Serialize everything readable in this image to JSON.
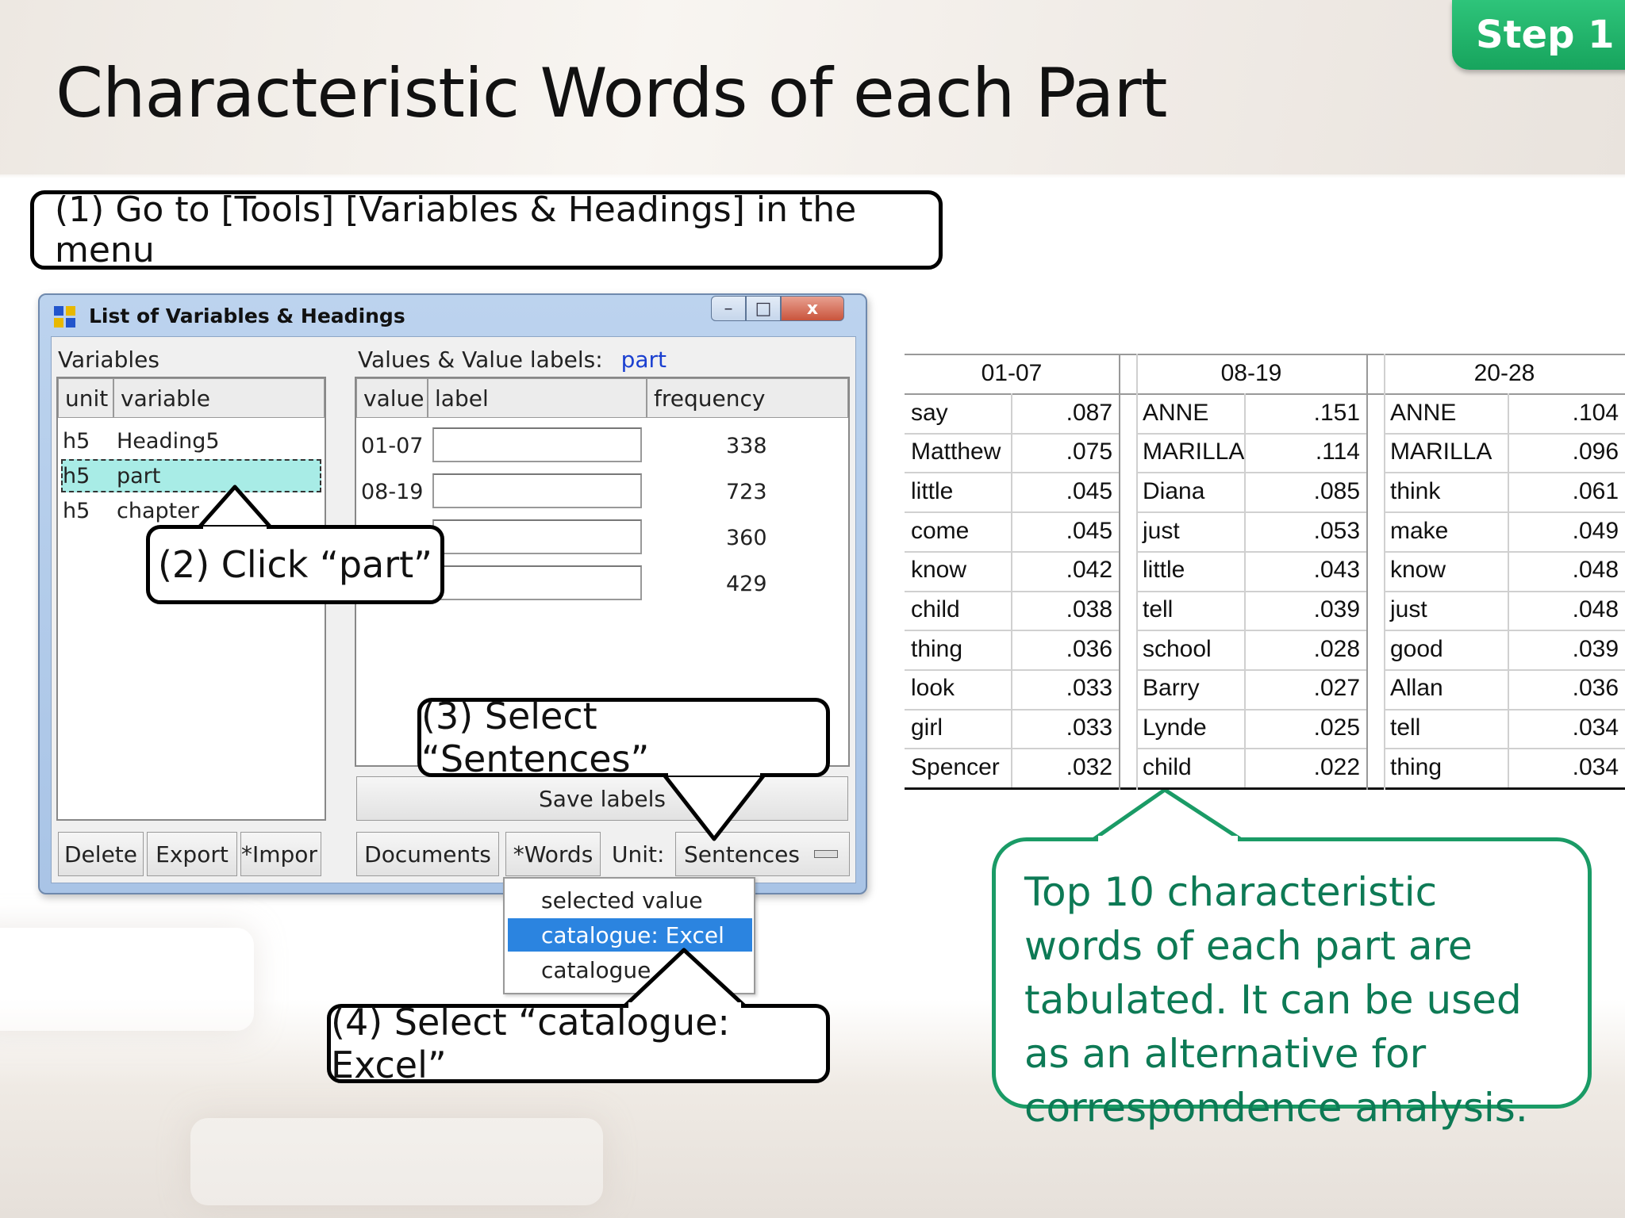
{
  "slide": {
    "title": "Characteristic Words of each Part",
    "badge": "Step 1"
  },
  "callouts": {
    "step1": "(1) Go to [Tools] [Variables & Headings] in the menu",
    "step2": "(2) Click “part”",
    "step3": "(3) Select “Sentences”",
    "step4": "(4) Select “catalogue: Excel”",
    "summary": "Top 10 characteristic words of each part are tabulated. It can be used as an alternative for correspondence analysis."
  },
  "window": {
    "title": "List of Variables & Headings",
    "controls": {
      "minimize": "–",
      "maximize": "□",
      "close": "x"
    },
    "variables_label": "Variables",
    "variables_headers": [
      "unit",
      "variable"
    ],
    "variables_rows": [
      {
        "unit": "h5",
        "variable": "Heading5"
      },
      {
        "unit": "h5",
        "variable": "part"
      },
      {
        "unit": "h5",
        "variable": "chapter"
      }
    ],
    "values_label": "Values & Value labels:",
    "values_var": "part",
    "values_headers": [
      "value",
      "label",
      "frequency"
    ],
    "values_rows": [
      {
        "value": "01-07",
        "frequency": "338"
      },
      {
        "value": "08-19",
        "frequency": "723"
      },
      {
        "value": "",
        "frequency": "360"
      },
      {
        "value": "",
        "frequency": "429"
      }
    ],
    "buttons": {
      "save_labels": "Save labels",
      "delete": "Delete",
      "export": "Export",
      "import": "*Impor",
      "documents": "Documents",
      "words": "*Words",
      "unit_label": "Unit:",
      "unit_value": "Sentences"
    },
    "dropdown": [
      "selected value",
      "catalogue: Excel",
      "catalogue"
    ]
  },
  "table": {
    "parts": [
      "01-07",
      "08-19",
      "20-28"
    ],
    "rows": [
      [
        [
          "say",
          ".087"
        ],
        [
          "ANNE",
          ".151"
        ],
        [
          "ANNE",
          ".104"
        ]
      ],
      [
        [
          "Matthew",
          ".075"
        ],
        [
          "MARILLA",
          ".114"
        ],
        [
          "MARILLA",
          ".096"
        ]
      ],
      [
        [
          "little",
          ".045"
        ],
        [
          "Diana",
          ".085"
        ],
        [
          "think",
          ".061"
        ]
      ],
      [
        [
          "come",
          ".045"
        ],
        [
          "just",
          ".053"
        ],
        [
          "make",
          ".049"
        ]
      ],
      [
        [
          "know",
          ".042"
        ],
        [
          "little",
          ".043"
        ],
        [
          "know",
          ".048"
        ]
      ],
      [
        [
          "child",
          ".038"
        ],
        [
          "tell",
          ".039"
        ],
        [
          "just",
          ".048"
        ]
      ],
      [
        [
          "thing",
          ".036"
        ],
        [
          "school",
          ".028"
        ],
        [
          "good",
          ".039"
        ]
      ],
      [
        [
          "look",
          ".033"
        ],
        [
          "Barry",
          ".027"
        ],
        [
          "Allan",
          ".036"
        ]
      ],
      [
        [
          "girl",
          ".033"
        ],
        [
          "Lynde",
          ".025"
        ],
        [
          "tell",
          ".034"
        ]
      ],
      [
        [
          "Spencer",
          ".032"
        ],
        [
          "child",
          ".022"
        ],
        [
          "thing",
          ".034"
        ]
      ]
    ]
  },
  "colors": {
    "badge": "#1fae66",
    "summary_border": "#1a9b66",
    "summary_text": "#0d7a55",
    "selection": "#a8ece6",
    "dropdown_active": "#2b84e0",
    "link_blue": "#1a3fd0"
  }
}
